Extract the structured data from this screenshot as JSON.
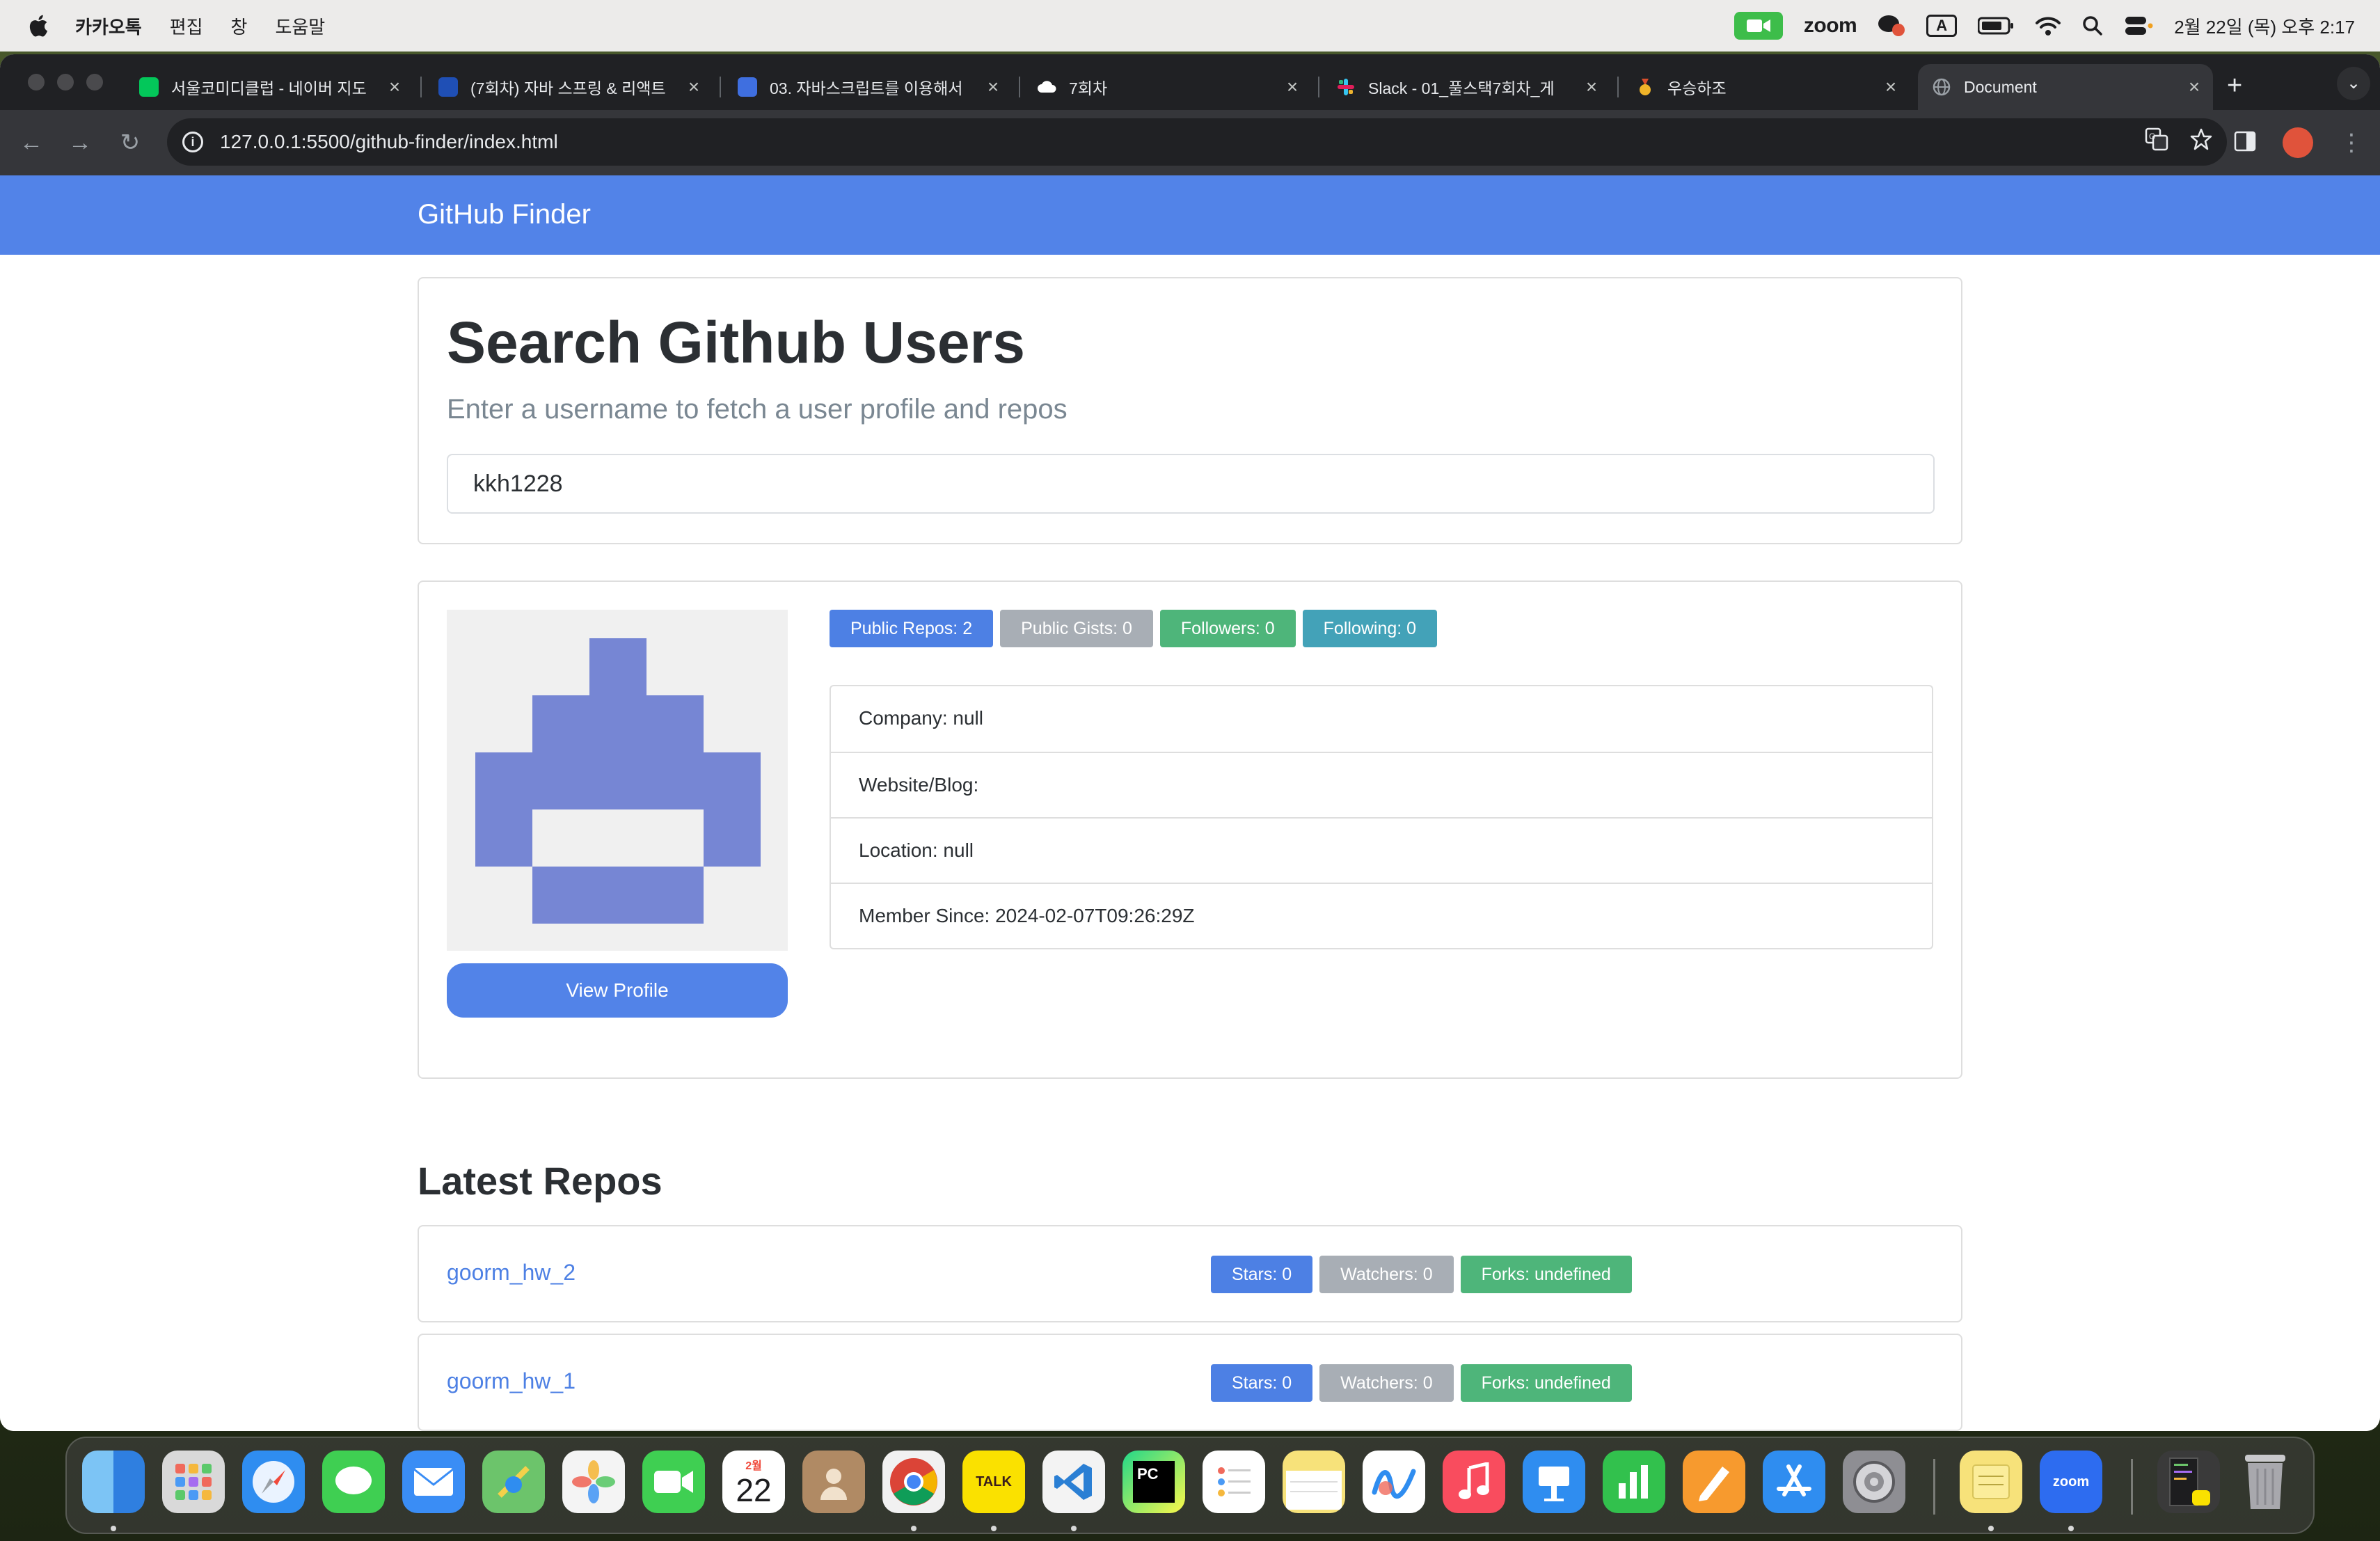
{
  "menubar": {
    "app_name": "카카오톡",
    "menus": [
      "편집",
      "창",
      "도움말"
    ],
    "status_zoom": "zoom",
    "input_source": "A",
    "datetime": "2월 22일 (목) 오후 2:17"
  },
  "browser": {
    "tabs": [
      {
        "title": "서울코미디클럽 - 네이버 지도",
        "favicon_color": "#03c75a"
      },
      {
        "title": "(7회차) 자바 스프링 & 리액트",
        "favicon_color": "#1f4fb5"
      },
      {
        "title": "03. 자바스크립트를 이용해서",
        "favicon_color": "#3f6fe0"
      },
      {
        "title": "7회차",
        "favicon_color": "#ffffff"
      },
      {
        "title": "Slack - 01_풀스택7회차_게",
        "favicon_color": "#e01e5a"
      },
      {
        "title": "우승하조",
        "favicon_color": "#d94f2b"
      },
      {
        "title": "Document",
        "favicon_color": "#9aa0a6"
      }
    ],
    "new_tab": "+",
    "url": "127.0.0.1:5500/github-finder/index.html"
  },
  "app": {
    "brand": "GitHub Finder",
    "search": {
      "title": "Search Github Users",
      "subtitle": "Enter a username to fetch a user profile and repos",
      "value": "kkh1228"
    },
    "profile": {
      "view_profile": "View Profile",
      "badges": [
        {
          "label": "Public Repos: 2",
          "color": "#4d80e4"
        },
        {
          "label": "Public Gists: 0",
          "color": "#a8aeb5"
        },
        {
          "label": "Followers: 0",
          "color": "#4eb57a"
        },
        {
          "label": "Following: 0",
          "color": "#43a2b8"
        }
      ],
      "info": [
        "Company: null",
        "Website/Blog:",
        "Location: null",
        "Member Since: 2024-02-07T09:26:29Z"
      ],
      "identicon_color": "#7686d4"
    },
    "repos_heading": "Latest Repos",
    "repos": [
      {
        "name": "goorm_hw_2",
        "stars": "Stars: 0",
        "watchers": "Watchers: 0",
        "forks": "Forks: undefined"
      },
      {
        "name": "goorm_hw_1",
        "stars": "Stars: 0",
        "watchers": "Watchers: 0",
        "forks": "Forks: undefined"
      }
    ]
  },
  "dock": {
    "apps": [
      {
        "name": "Finder",
        "color": "#4aa3f0"
      },
      {
        "name": "Launchpad",
        "color": "#d9d9d9"
      },
      {
        "name": "Safari",
        "color": "#2f8df0"
      },
      {
        "name": "Messages",
        "color": "#3fcf52"
      },
      {
        "name": "Mail",
        "color": "#3a8df5"
      },
      {
        "name": "Maps",
        "color": "#6cc46b"
      },
      {
        "name": "Photos",
        "color": "#f4f4f4"
      },
      {
        "name": "FaceTime",
        "color": "#3fcf52"
      },
      {
        "name": "Calendar",
        "color": "#ffffff"
      },
      {
        "name": "Contacts",
        "color": "#b08a64"
      },
      {
        "name": "Chrome",
        "color": "#f1f1f1"
      },
      {
        "name": "KakaoTalk",
        "color": "#fae100"
      },
      {
        "name": "VS Code",
        "color": "#f3f3f3"
      },
      {
        "name": "PyCharm",
        "color": "#21d789"
      },
      {
        "name": "Reminders",
        "color": "#ffffff"
      },
      {
        "name": "Notes",
        "color": "#f7e27a"
      },
      {
        "name": "Freeform",
        "color": "#ffffff"
      },
      {
        "name": "Music",
        "color": "#f94c5e"
      },
      {
        "name": "Keynote",
        "color": "#2f8df0"
      },
      {
        "name": "Numbers",
        "color": "#32c14d"
      },
      {
        "name": "Pages",
        "color": "#f79a2e"
      },
      {
        "name": "App Store",
        "color": "#2f8df0"
      },
      {
        "name": "System Settings",
        "color": "#8e8e93"
      },
      {
        "name": "Stickies",
        "color": "#f7e27a"
      },
      {
        "name": "Zoom",
        "color": "#2d6cf0"
      },
      {
        "name": "Downloads",
        "color": "#3a3a3a"
      },
      {
        "name": "Trash",
        "color": "#9a9a9a"
      }
    ],
    "calendar_month": "2월",
    "calendar_day": "22",
    "kakao_label": "TALK",
    "pycharm_label": "PC",
    "zoom_label": "zoom"
  }
}
